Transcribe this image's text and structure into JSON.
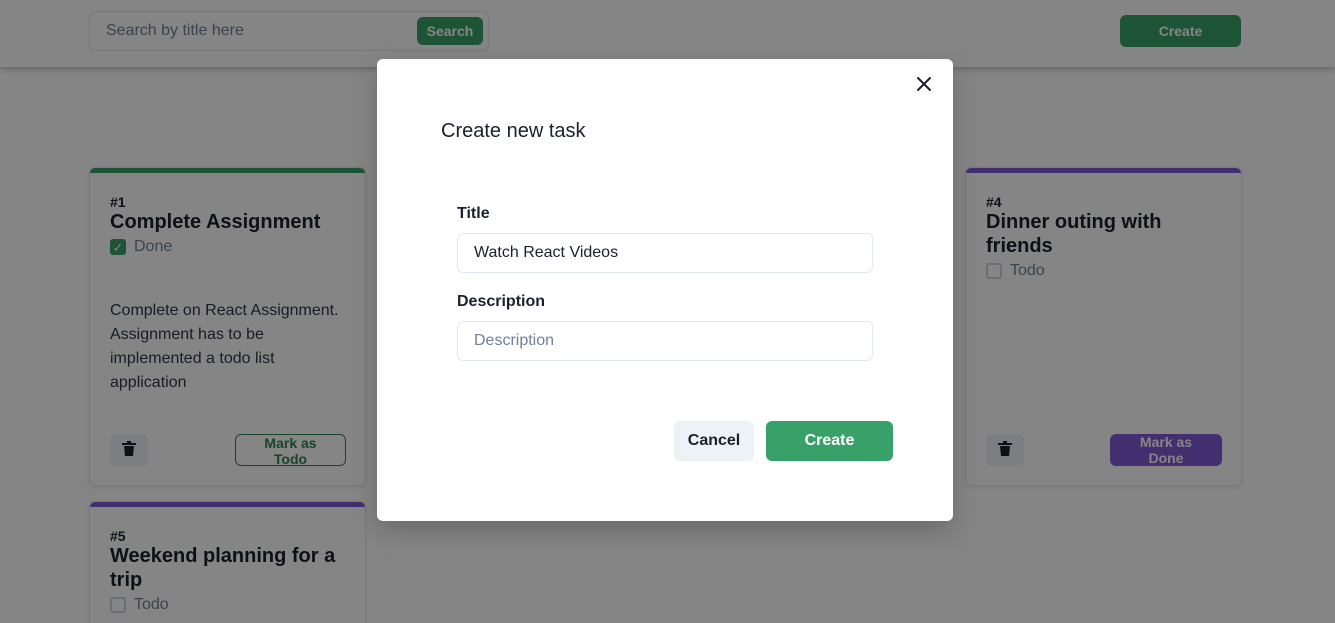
{
  "colors": {
    "green": "#38a169",
    "purple": "#805ad5",
    "overlay": "rgba(0,0,0,0.48)"
  },
  "header": {
    "search_placeholder": "Search by title here",
    "search_label": "Search",
    "create_label": "Create"
  },
  "tasks": [
    {
      "number": "#1",
      "title": "Complete Assignment",
      "status": "Done",
      "done": true,
      "description": "Complete on React Assignment. Assignment has to be implemented a todo list application",
      "action_label": "Mark as Todo",
      "accent": "#38a169",
      "trash_icon": "trash-icon"
    },
    {
      "number": "#4",
      "title": "Dinner outing with friends",
      "status": "Todo",
      "done": false,
      "description": "",
      "action_label": "Mark as Done",
      "accent": "#805ad5",
      "trash_icon": "trash-icon"
    },
    {
      "number": "#5",
      "title": "Weekend planning for a trip",
      "status": "Todo",
      "done": false,
      "accent": "#805ad5"
    }
  ],
  "modal": {
    "title": "Create new task",
    "title_label": "Title",
    "title_value": "Watch React Videos",
    "description_label": "Description",
    "description_placeholder": "Description",
    "cancel_label": "Cancel",
    "create_label": "Create",
    "close_icon": "close-icon"
  }
}
